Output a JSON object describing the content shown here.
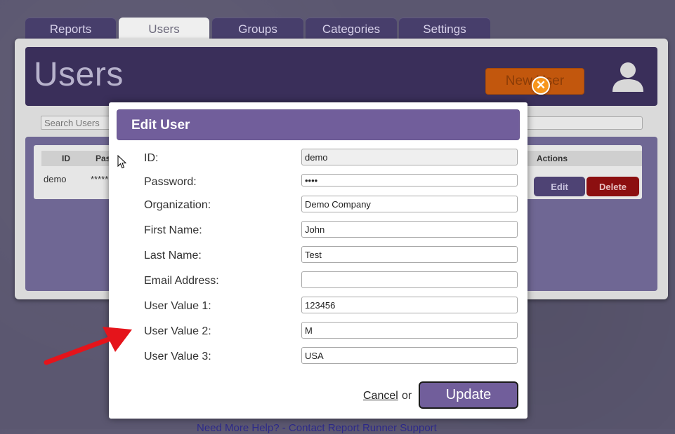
{
  "tabs": [
    {
      "label": "Reports",
      "active": false
    },
    {
      "label": "Users",
      "active": true
    },
    {
      "label": "Groups",
      "active": false
    },
    {
      "label": "Categories",
      "active": false
    },
    {
      "label": "Settings",
      "active": false
    }
  ],
  "header": {
    "title": "Users",
    "new_user_label": "New User",
    "avatar_icon": "user-icon"
  },
  "search": {
    "placeholder": "Search Users"
  },
  "table": {
    "headers": {
      "id": "ID",
      "password": "Pas",
      "actions": "Actions"
    },
    "rows": [
      {
        "id": "demo",
        "password": "*****",
        "edit_label": "Edit",
        "delete_label": "Delete"
      }
    ]
  },
  "footer": {
    "text": "Need More Help? - Contact Report Runner Support"
  },
  "modal": {
    "title": "Edit User",
    "close_icon": "close-icon",
    "fields": [
      {
        "label": "ID:",
        "value": "demo"
      },
      {
        "label": "Password:",
        "value": "••••"
      },
      {
        "label": "Organization:",
        "value": "Demo Company"
      },
      {
        "label": "First Name:",
        "value": "John"
      },
      {
        "label": "Last Name:",
        "value": "Test"
      },
      {
        "label": "Email Address:",
        "value": ""
      },
      {
        "label": "User Value 1:",
        "value": "123456"
      },
      {
        "label": "User Value 2:",
        "value": "M"
      },
      {
        "label": "User Value 3:",
        "value": "USA"
      }
    ],
    "cancel_label": "Cancel",
    "or_text": "or",
    "update_label": "Update"
  },
  "colors": {
    "accent": "#715e9b",
    "header_bg": "#3a2f5a",
    "new_user_orange": "#c2570d",
    "close_orange": "#f7961c",
    "delete_red": "#8c0f10",
    "annotation_arrow": "#e5141b"
  }
}
